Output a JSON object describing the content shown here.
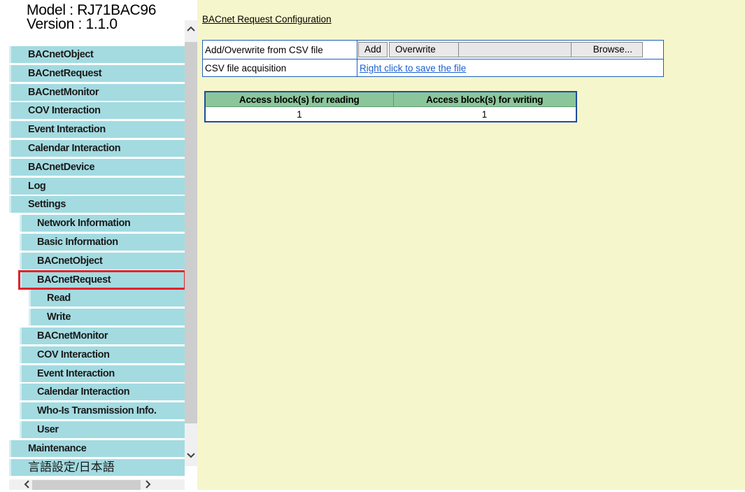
{
  "sidebar": {
    "model": "Model : RJ71BAC96",
    "version": "Version : 1.1.0",
    "items": [
      {
        "label": "BACnetObject"
      },
      {
        "label": "BACnetRequest"
      },
      {
        "label": "BACnetMonitor"
      },
      {
        "label": "COV Interaction"
      },
      {
        "label": "Event Interaction"
      },
      {
        "label": "Calendar Interaction"
      },
      {
        "label": "BACnetDevice"
      },
      {
        "label": "Log"
      },
      {
        "label": "Settings"
      },
      {
        "label": "Network Information"
      },
      {
        "label": "Basic Information"
      },
      {
        "label": "BACnetObject"
      },
      {
        "label": "BACnetRequest"
      },
      {
        "label": "Read"
      },
      {
        "label": "Write"
      },
      {
        "label": "BACnetMonitor"
      },
      {
        "label": "COV Interaction"
      },
      {
        "label": "Event Interaction"
      },
      {
        "label": "Calendar Interaction"
      },
      {
        "label": "Who-Is Transmission Info."
      },
      {
        "label": "User"
      },
      {
        "label": "Maintenance"
      },
      {
        "label": "言語設定/日本語"
      }
    ],
    "selected_item": "BACnetRequest",
    "selected_color": "#e0232a"
  },
  "main": {
    "breadcrumb": "BACnet Request Configuration",
    "csv": {
      "add_overwrite_label": "Add/Overwrite from CSV file",
      "add_button": "Add",
      "overwrite_button": "Overwrite",
      "browse_button": "Browse...",
      "acquisition_label": "CSV file acquisition",
      "acquisition_link": "Right click to save the file"
    },
    "access_table": {
      "headers": [
        "Access block(s) for reading",
        "Access block(s) for writing"
      ],
      "rows": [
        [
          "1",
          "1"
        ]
      ]
    }
  },
  "colors": {
    "nav_background": "#a3dbe1",
    "main_background": "#f6f6cc",
    "table_header": "#8bc69a",
    "link": "#1a5fd1"
  },
  "icons": {
    "scroll_up": "chevron-up-icon",
    "scroll_down": "chevron-down-icon",
    "scroll_left": "chevron-left-icon",
    "scroll_right": "chevron-right-icon"
  }
}
